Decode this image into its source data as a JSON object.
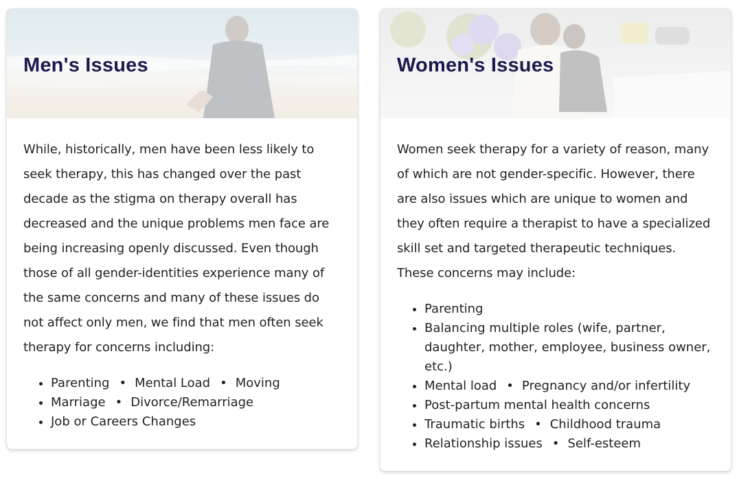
{
  "men": {
    "title": "Men's Issues",
    "paragraph": "While, historically, men have been less likely to seek therapy, this has changed over the past decade as the stigma on therapy overall has decreased and the unique problems men face are being increasing openly discussed. Even though those of all gender-identities experience many of the same concerns and many of these issues do not affect only men, we find that men often seek therapy for concerns including:",
    "rows": [
      [
        "Parenting",
        "Mental Load",
        "Moving"
      ],
      [
        "Marriage",
        "Divorce/Remarriage"
      ],
      [
        "Job or Careers Changes"
      ]
    ]
  },
  "women": {
    "title": "Women's Issues",
    "paragraph": "Women seek therapy for a variety of reason, many of which are not gender-specific. However, there are also issues which are unique to women and they often require a therapist to have a specialized skill set and targeted therapeutic techniques. These concerns may include:",
    "rows": [
      [
        "Parenting"
      ],
      [
        "Balancing multiple roles (wife, partner, daughter, mother, employee, business owner, etc.)"
      ],
      [
        "Mental load",
        "Pregnancy and/or infertility"
      ],
      [
        "Post-partum mental health concerns"
      ],
      [
        "Traumatic births",
        "Childhood trauma"
      ],
      [
        "Relationship issues",
        "Self-esteem"
      ]
    ]
  },
  "colors": {
    "title": "#1b1a4e",
    "text": "#222222",
    "card_border": "#e6e6e6"
  }
}
